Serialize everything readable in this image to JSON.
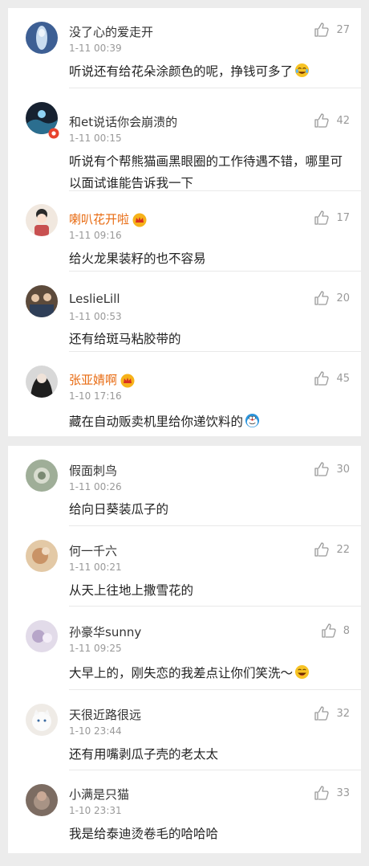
{
  "comments": [
    {
      "name": "没了心的爱走开",
      "time": "1-11 00:39",
      "text": "听说还有给花朵涂颜色的呢，挣钱可多了",
      "likes": "27",
      "vip": false,
      "emoji": "laugh-cry-emoji",
      "avatar_color": "#4a6fa5"
    },
    {
      "name": "和et说话你会崩溃的",
      "time": "1-11 00:15",
      "text": "听说有个帮熊猫画黑眼圈的工作待遇不错，哪里可以面试谁能告诉我一下",
      "likes": "42",
      "vip": false,
      "emoji": null,
      "avatar_color": "#1e2a38"
    },
    {
      "name": "喇叭花开啦",
      "time": "1-11 09:16",
      "text": "给火龙果装籽的也不容易",
      "likes": "17",
      "vip": true,
      "emoji": null,
      "avatar_color": "#f2e6dd"
    },
    {
      "name": "LeslieLill",
      "time": "1-11 00:53",
      "text": "还有给斑马粘胶带的",
      "likes": "20",
      "vip": false,
      "emoji": null,
      "avatar_color": "#6e5a48"
    },
    {
      "name": "张亚婧啊",
      "time": "1-10 17:16",
      "text": "藏在自动贩卖机里给你递饮料的",
      "likes": "45",
      "vip": true,
      "emoji": "doraemon-emoji",
      "avatar_color": "#3a3a3a"
    },
    {
      "name": "假面刺鸟",
      "time": "1-11 00:26",
      "text": "给向日葵装瓜子的",
      "likes": "30",
      "vip": false,
      "emoji": null,
      "avatar_color": "#9aa893"
    },
    {
      "name": "何一千六",
      "time": "1-11 00:21",
      "text": "从天上往地上撒雪花的",
      "likes": "22",
      "vip": false,
      "emoji": null,
      "avatar_color": "#d9b48a"
    },
    {
      "name": "孙豪华sunny",
      "time": "1-11 09:25",
      "text": "大早上的，刚失恋的我差点让你们笑洗～",
      "likes": "8",
      "vip": false,
      "emoji": "laugh-emoji",
      "avatar_color": "#d8cfe0"
    },
    {
      "name": "天很近路很远",
      "time": "1-10 23:44",
      "text": "还有用嘴剥瓜子壳的老太太",
      "likes": "32",
      "vip": false,
      "emoji": null,
      "avatar_color": "#e8e4df"
    },
    {
      "name": "小满是只猫",
      "time": "1-10 23:31",
      "text": "我是给泰迪烫卷毛的哈哈哈",
      "likes": "33",
      "vip": false,
      "emoji": null,
      "avatar_color": "#8a7a70"
    }
  ],
  "icons": {
    "like": "thumbs-up-icon",
    "vip": "crown-badge-icon"
  },
  "colors": {
    "vip_name": "#e86b12",
    "name": "#333333",
    "time": "#999999",
    "text": "#222222",
    "like": "#9a9a9a",
    "background": "#ececec"
  }
}
